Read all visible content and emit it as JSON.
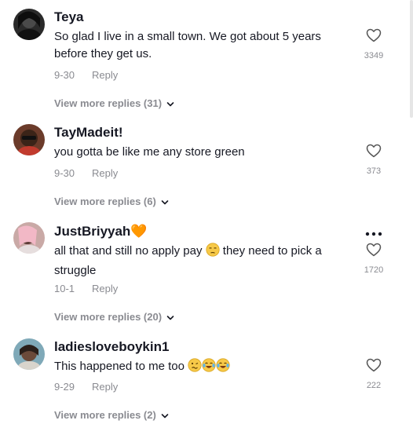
{
  "comments": [
    {
      "username": "Teya",
      "text": "So glad I live in a small town. We got about 5 years before they get us.",
      "date": "9-30",
      "reply_label": "Reply",
      "likes": "3349",
      "view_replies": "View more replies (31)"
    },
    {
      "username": "TayMadeit!",
      "text": "you gotta be like me any store green",
      "date": "9-30",
      "reply_label": "Reply",
      "likes": "373",
      "view_replies": "View more replies (6)"
    },
    {
      "username": "JustBriyyah🧡",
      "text_before_emoji": "all that and still no apply pay ",
      "emoji_1": "unamused-face",
      "text_after_emoji": " they need to pick a struggle",
      "date": "10-1",
      "reply_label": "Reply",
      "likes": "1720",
      "view_replies": "View more replies (20)"
    },
    {
      "username": "ladiesloveboykin1",
      "text": "This happened to me too ",
      "emojis": [
        "woozy-face",
        "tears-of-joy-face",
        "tears-of-joy-face"
      ],
      "date": "9-29",
      "reply_label": "Reply",
      "likes": "222",
      "view_replies": "View more replies (2)"
    }
  ],
  "colors": {
    "text": "#161823",
    "muted": "#8a8b91",
    "heart_outline": "#8a8b91",
    "emoji_yellow": "#f7c948"
  },
  "icons": [
    "heart-outline-icon",
    "chevron-down-icon",
    "more-options-icon"
  ]
}
